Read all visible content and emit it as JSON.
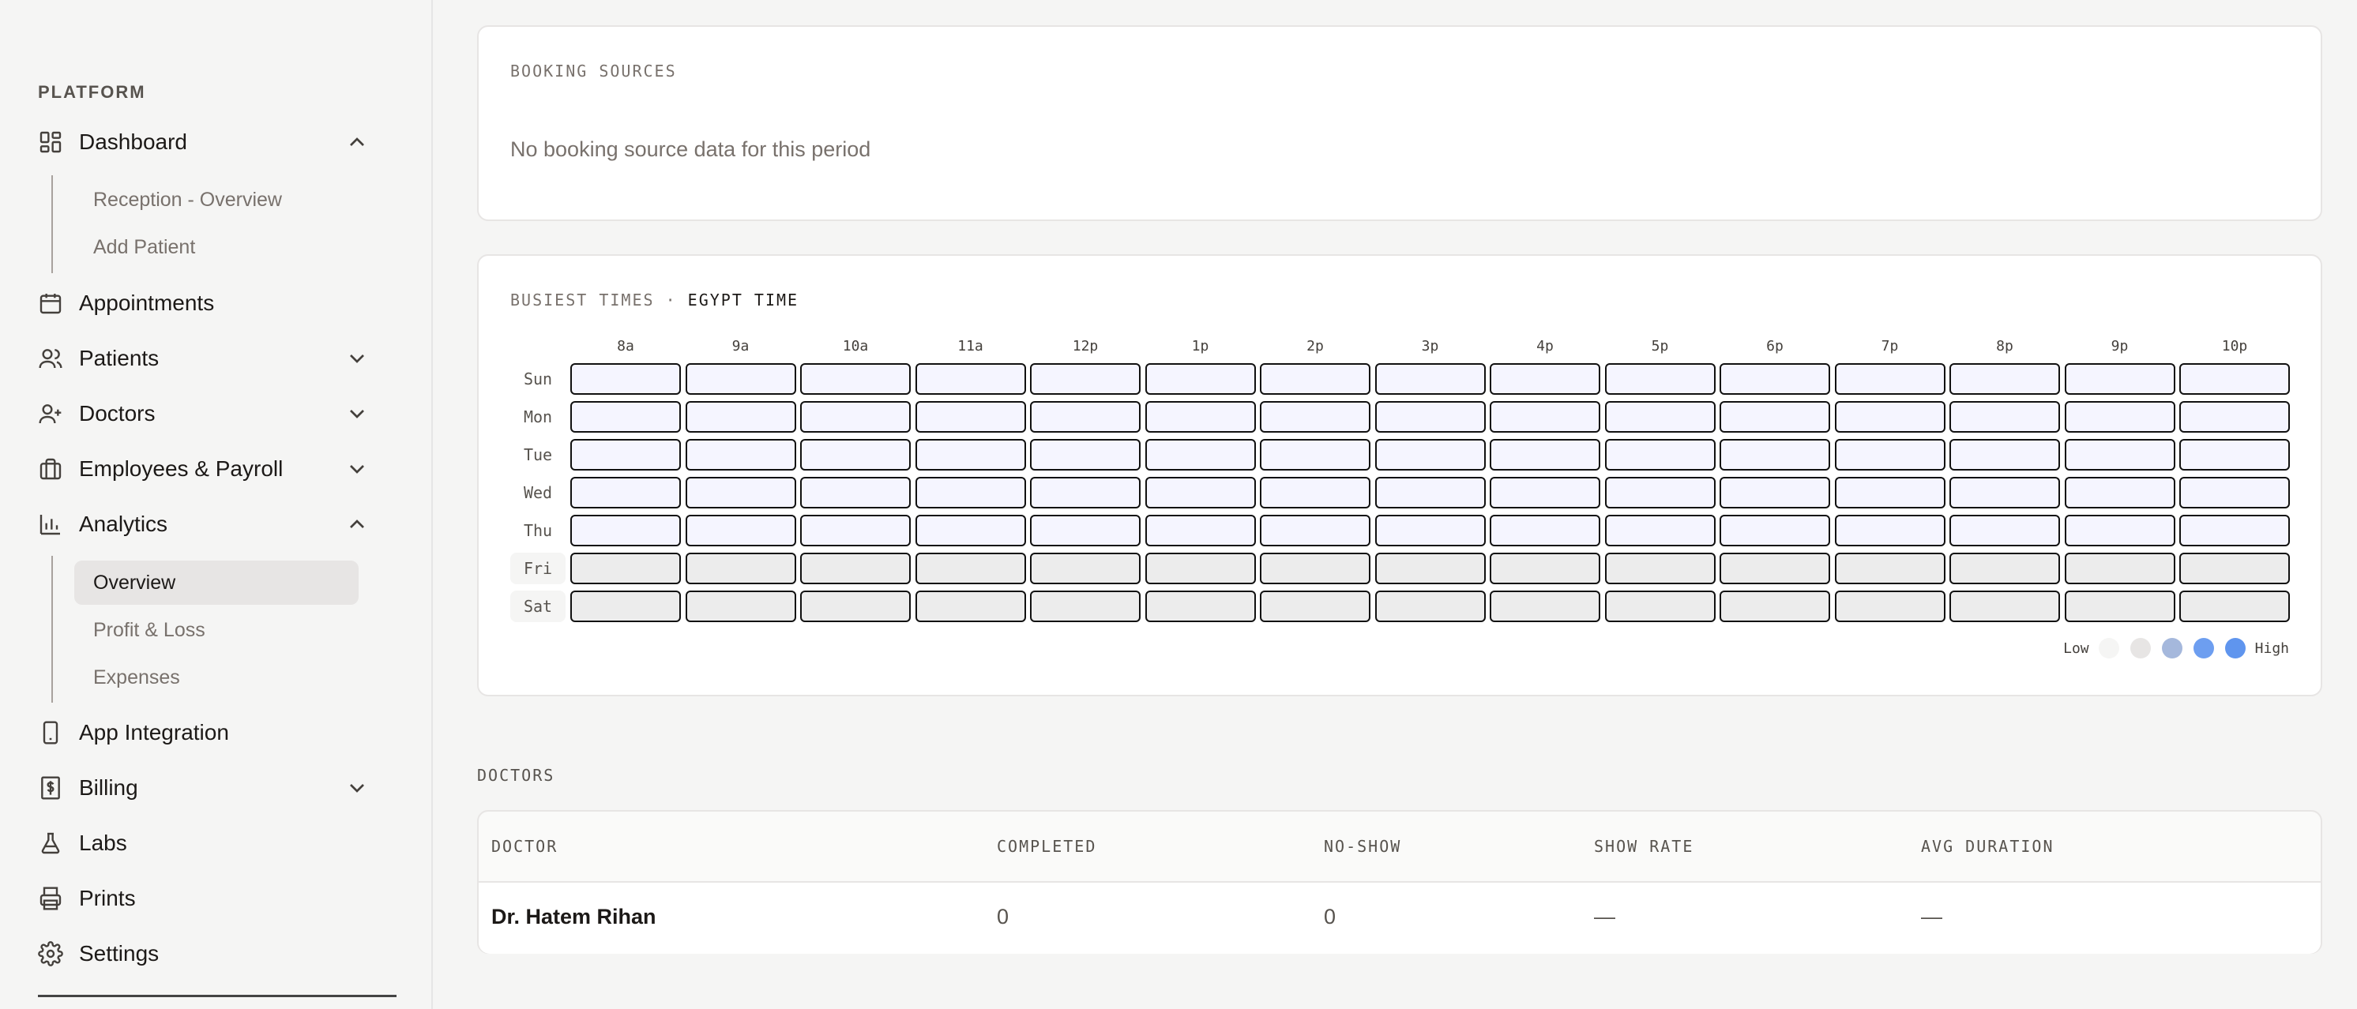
{
  "sidebar": {
    "heading": "PLATFORM",
    "items": [
      {
        "label": "Dashboard"
      },
      {
        "label": "Appointments"
      },
      {
        "label": "Patients"
      },
      {
        "label": "Doctors"
      },
      {
        "label": "Employees & Payroll"
      },
      {
        "label": "Analytics"
      },
      {
        "label": "App Integration"
      },
      {
        "label": "Billing"
      },
      {
        "label": "Labs"
      },
      {
        "label": "Prints"
      },
      {
        "label": "Settings"
      }
    ],
    "dashboard_sub": [
      "Reception - Overview",
      "Add Patient"
    ],
    "analytics_sub": [
      "Overview",
      "Profit & Loss",
      "Expenses"
    ]
  },
  "booking_sources": {
    "title": "BOOKING SOURCES",
    "empty_message": "No booking source data for this period"
  },
  "busiest_times": {
    "title_prefix": "BUSIEST TIMES ·",
    "title_tz": "EGYPT TIME",
    "hours": [
      "8a",
      "9a",
      "10a",
      "11a",
      "12p",
      "1p",
      "2p",
      "3p",
      "4p",
      "5p",
      "6p",
      "7p",
      "8p",
      "9p",
      "10p"
    ],
    "days": [
      "Sun",
      "Mon",
      "Tue",
      "Wed",
      "Thu",
      "Fri",
      "Sat"
    ],
    "weekend_days": [
      "Fri",
      "Sat"
    ],
    "legend_low": "Low",
    "legend_high": "High",
    "legend_colors": [
      "#f5f5f4",
      "#e7e5e4",
      "#a5b8dc",
      "#6d9ef0",
      "#5f95ee"
    ]
  },
  "doctors": {
    "section_label": "DOCTORS",
    "columns": [
      "DOCTOR",
      "COMPLETED",
      "NO-SHOW",
      "SHOW RATE",
      "AVG DURATION"
    ],
    "rows": [
      {
        "doctor": "Dr. Hatem Rihan",
        "completed": "0",
        "no_show": "0",
        "show_rate": "—",
        "avg_duration": "—"
      }
    ]
  }
}
